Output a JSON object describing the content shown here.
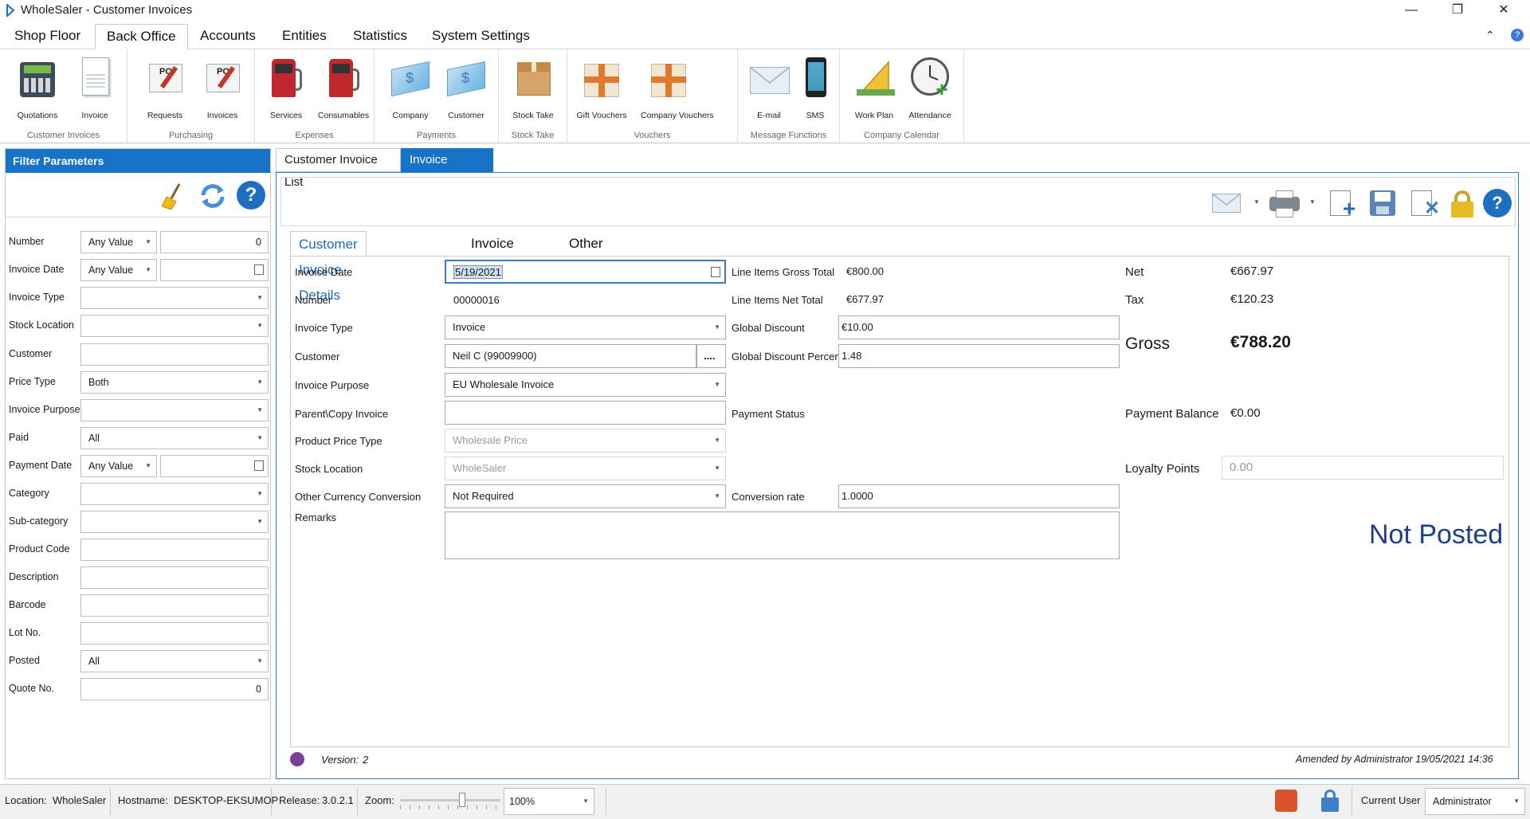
{
  "window": {
    "title": "WholeSaler - Customer Invoices"
  },
  "menu": [
    "Shop Floor",
    "Back Office",
    "Accounts",
    "Entities",
    "Statistics",
    "System Settings"
  ],
  "ribbon": {
    "groups": [
      {
        "label": "Customer Invoices",
        "items": [
          "Quotations",
          "Invoice"
        ]
      },
      {
        "label": "Purchasing",
        "items": [
          "Requests",
          "Invoices"
        ]
      },
      {
        "label": "Expenses",
        "items": [
          "Services",
          "Consumables"
        ]
      },
      {
        "label": "Payments",
        "items": [
          "Company",
          "Customer"
        ]
      },
      {
        "label": "Stock Take",
        "items": [
          "Stock Take"
        ]
      },
      {
        "label": "Vouchers",
        "items": [
          "Gift Vouchers",
          "Company Vouchers"
        ]
      },
      {
        "label": "Message Functions",
        "items": [
          "E-mail",
          "SMS"
        ]
      },
      {
        "label": "Company Calendar",
        "items": [
          "Work Plan",
          "Attendance"
        ]
      }
    ]
  },
  "filter": {
    "title": "Filter Parameters",
    "rows": [
      {
        "label": "Number",
        "select": "Any Value",
        "value": "0"
      },
      {
        "label": "Invoice Date",
        "select": "Any Value",
        "value": ""
      },
      {
        "label": "Invoice Type",
        "value": ""
      },
      {
        "label": "Stock Location",
        "value": ""
      },
      {
        "label": "Customer",
        "value": ""
      },
      {
        "label": "Price Type",
        "value": "Both"
      },
      {
        "label": "Invoice Purpose",
        "value": ""
      },
      {
        "label": "Paid",
        "value": "All"
      },
      {
        "label": "Payment Date",
        "select": "Any Value",
        "value": ""
      },
      {
        "label": "Category",
        "value": ""
      },
      {
        "label": "Sub-category",
        "value": ""
      },
      {
        "label": "Product Code",
        "value": ""
      },
      {
        "label": "Description",
        "value": ""
      },
      {
        "label": "Barcode",
        "value": ""
      },
      {
        "label": "Lot No.",
        "value": ""
      },
      {
        "label": "Posted",
        "value": "All"
      },
      {
        "label": "Quote No.",
        "value": "0"
      }
    ]
  },
  "tabs": [
    "Customer Invoice List",
    "Invoice Details"
  ],
  "inner_tabs": [
    "Customer Invoice Details",
    "Invoice Lines",
    "Other Information"
  ],
  "details": {
    "invoice_date_label": "Invoice Date",
    "invoice_date": "5/19/2021",
    "number_label": "Number",
    "number": "00000016",
    "invoice_type_label": "Invoice Type",
    "invoice_type": "Invoice",
    "customer_label": "Customer",
    "customer": "Neil C (99009900)",
    "customer_lookup": "....",
    "purpose_label": "Invoice Purpose",
    "purpose": "EU Wholesale Invoice",
    "parent_label": "Parent\\Copy Invoice",
    "parent": "",
    "price_type_label": "Product Price Type",
    "price_type": "Wholesale Price",
    "stock_location_label": "Stock Location",
    "stock_location": "WholeSaler",
    "currency_label": "Other Currency Conversion",
    "currency": "Not Required",
    "remarks_label": "Remarks",
    "remarks": "",
    "gross_total_label": "Line Items Gross Total",
    "gross_total": "€800.00",
    "net_total_label": "Line Items Net Total",
    "net_total": "€677.97",
    "global_discount_label": "Global Discount",
    "global_discount": "€10.00",
    "global_discount_pct_label": "Global Discount Percent",
    "global_discount_pct": "1.48",
    "payment_status_label": "Payment Status",
    "conversion_rate_label": "Conversion rate",
    "conversion_rate": "1.0000",
    "net_label": "Net",
    "net": "€667.97",
    "tax_label": "Tax",
    "tax": "€120.23",
    "gross_label": "Gross",
    "gross": "€788.20",
    "payment_balance_label": "Payment Balance",
    "payment_balance": "€0.00",
    "loyalty_label": "Loyalty Points",
    "loyalty": "0.00",
    "status": "Not Posted"
  },
  "footer": {
    "version_label": "Version:",
    "version": "2",
    "amended": "Amended by Administrator 19/05/2021 14:36"
  },
  "statusbar": {
    "location_label": "Location:",
    "location": "WholeSaler",
    "hostname_label": "Hostname:",
    "hostname": "DESKTOP-EKSUMOP",
    "release_label": "Release:",
    "release": "3.0.2.1",
    "zoom_label": "Zoom:",
    "zoom": "100%",
    "user_label": "Current User",
    "user": "Administrator"
  },
  "colors": {
    "accent": "#1673c5",
    "status_blue": "#1f3e8c"
  }
}
